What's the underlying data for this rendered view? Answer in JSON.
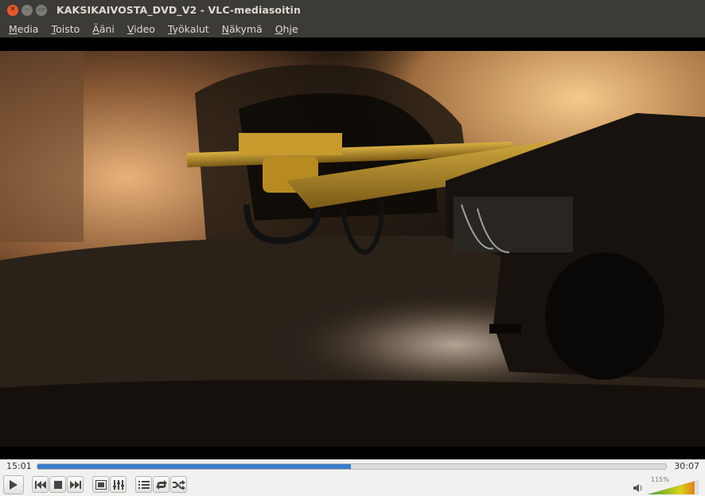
{
  "window": {
    "title": "KAKSIKAIVOSTA_DVD_V2 - VLC-mediasoitin"
  },
  "menu": [
    {
      "label_ul": "M",
      "label_rest": "edia"
    },
    {
      "label_ul": "T",
      "label_rest": "oisto"
    },
    {
      "label_ul": "Ä",
      "label_rest": "äni"
    },
    {
      "label_ul": "V",
      "label_rest": "ideo"
    },
    {
      "label_ul": "T",
      "label_rest": "yökalut"
    },
    {
      "label_ul": "N",
      "label_rest": "äkymä"
    },
    {
      "label_ul": "O",
      "label_rest": "hje"
    }
  ],
  "playback": {
    "elapsed": "15:01",
    "total": "30:07",
    "progress_fraction": 0.4985
  },
  "volume": {
    "percent_label": "115%",
    "level_fraction": 1.15
  },
  "icons": {
    "play": "play-icon",
    "prev": "skip-previous-icon",
    "stop": "stop-icon",
    "next": "skip-next-icon",
    "fullscreen": "fullscreen-icon",
    "extended": "extended-settings-icon",
    "playlist": "playlist-icon",
    "loop": "loop-icon",
    "shuffle": "shuffle-icon",
    "volume": "speaker-icon"
  },
  "colors": {
    "titlebar": "#3c3b37",
    "seek_fill": "#3b7cc9",
    "close": "#e9592b"
  }
}
